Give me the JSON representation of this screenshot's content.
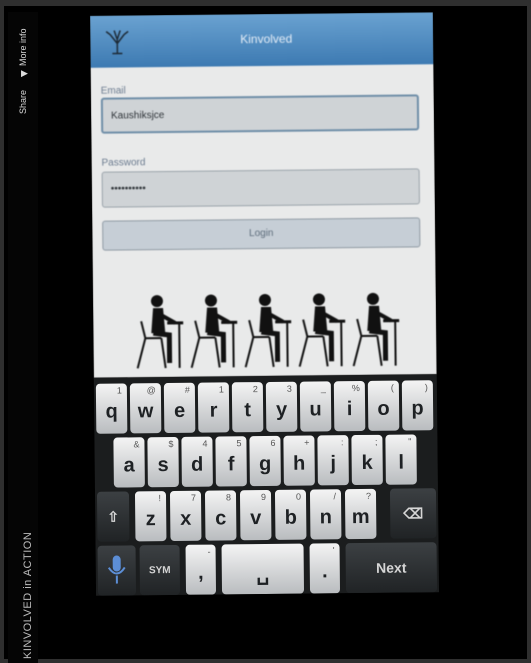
{
  "sidebar": {
    "more_info": "More info",
    "share": "Share",
    "brand": "KINVOLVED in ACTION"
  },
  "app": {
    "title": "Kinvolved",
    "email_label": "Email",
    "email_value": "Kaushiksjce",
    "password_label": "Password",
    "password_value": "••••••••••",
    "login_label": "Login"
  },
  "keyboard": {
    "row1": [
      {
        "main": "q",
        "hint": "1"
      },
      {
        "main": "w",
        "hint": "@"
      },
      {
        "main": "e",
        "hint": "#"
      },
      {
        "main": "r",
        "hint": "1"
      },
      {
        "main": "t",
        "hint": "2"
      },
      {
        "main": "y",
        "hint": "3"
      },
      {
        "main": "u",
        "hint": "_"
      },
      {
        "main": "i",
        "hint": "%"
      },
      {
        "main": "o",
        "hint": "("
      },
      {
        "main": "p",
        "hint": ")"
      }
    ],
    "row2": [
      {
        "main": "a",
        "hint": "&"
      },
      {
        "main": "s",
        "hint": "$"
      },
      {
        "main": "d",
        "hint": "4"
      },
      {
        "main": "f",
        "hint": "5"
      },
      {
        "main": "g",
        "hint": "6"
      },
      {
        "main": "h",
        "hint": "+"
      },
      {
        "main": "j",
        "hint": ":"
      },
      {
        "main": "k",
        "hint": ";"
      },
      {
        "main": "l",
        "hint": "\""
      }
    ],
    "row3": [
      {
        "main": "z",
        "hint": "!"
      },
      {
        "main": "x",
        "hint": "7"
      },
      {
        "main": "c",
        "hint": "8"
      },
      {
        "main": "v",
        "hint": "9"
      },
      {
        "main": "b",
        "hint": "0"
      },
      {
        "main": "n",
        "hint": "/"
      },
      {
        "main": "m",
        "hint": "?"
      }
    ],
    "shift": "⇧",
    "delete": "⌫",
    "sym": "SYM",
    "comma": ",",
    "comma_hint": "-",
    "space": "␣",
    "apostrophe": "'",
    "period": ".",
    "next": "Next"
  }
}
